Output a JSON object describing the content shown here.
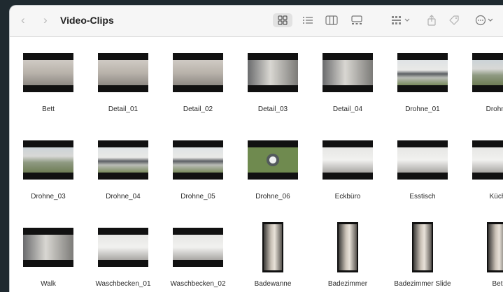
{
  "window": {
    "title": "Video-Clips"
  },
  "toolbar": {
    "back_icon": "chevron-left-icon",
    "forward_icon": "chevron-right-icon",
    "views": [
      "grid-view-icon",
      "list-view-icon",
      "column-view-icon",
      "gallery-view-icon"
    ],
    "group_icon": "group-by-icon",
    "share_icon": "share-icon",
    "tag_icon": "tag-icon",
    "more_icon": "more-actions-icon"
  },
  "colors": {
    "window_bg": "#ffffff",
    "toolbar_bg": "#f6f6f6",
    "selected_view_bg": "#e2e2e2",
    "text": "#2a2a2a"
  },
  "files": {
    "rows": [
      [
        {
          "name": "Bett",
          "kind": "land",
          "scene": "room"
        },
        {
          "name": "Detail_01",
          "kind": "land",
          "scene": "room"
        },
        {
          "name": "Detail_02",
          "kind": "land",
          "scene": "room"
        },
        {
          "name": "Detail_03",
          "kind": "land",
          "scene": "hall"
        },
        {
          "name": "Detail_04",
          "kind": "land",
          "scene": "hall"
        },
        {
          "name": "Drohne_01",
          "kind": "land",
          "scene": "house"
        },
        {
          "name": "Drohne",
          "kind": "land",
          "scene": "aerial"
        }
      ],
      [
        {
          "name": "Drohne_03",
          "kind": "land",
          "scene": "aerial"
        },
        {
          "name": "Drohne_04",
          "kind": "land",
          "scene": "house"
        },
        {
          "name": "Drohne_05",
          "kind": "land",
          "scene": "house"
        },
        {
          "name": "Drohne_06",
          "kind": "land",
          "scene": "top"
        },
        {
          "name": "Eckbüro",
          "kind": "land",
          "scene": "bright"
        },
        {
          "name": "Esstisch",
          "kind": "land",
          "scene": "bright"
        },
        {
          "name": "Küch",
          "kind": "land",
          "scene": "bright"
        }
      ],
      [
        {
          "name": "Walk",
          "kind": "land",
          "scene": "hall"
        },
        {
          "name": "Waschbecken_01",
          "kind": "land",
          "scene": "bright"
        },
        {
          "name": "Waschbecken_02",
          "kind": "land",
          "scene": "bright"
        },
        {
          "name": "Badewanne",
          "kind": "port",
          "scene": "tall"
        },
        {
          "name": "Badezimmer",
          "kind": "port",
          "scene": "tall"
        },
        {
          "name": "Badezimmer Slide",
          "kind": "port",
          "scene": "tall"
        },
        {
          "name": "Bet",
          "kind": "port",
          "scene": "tall"
        }
      ]
    ]
  }
}
